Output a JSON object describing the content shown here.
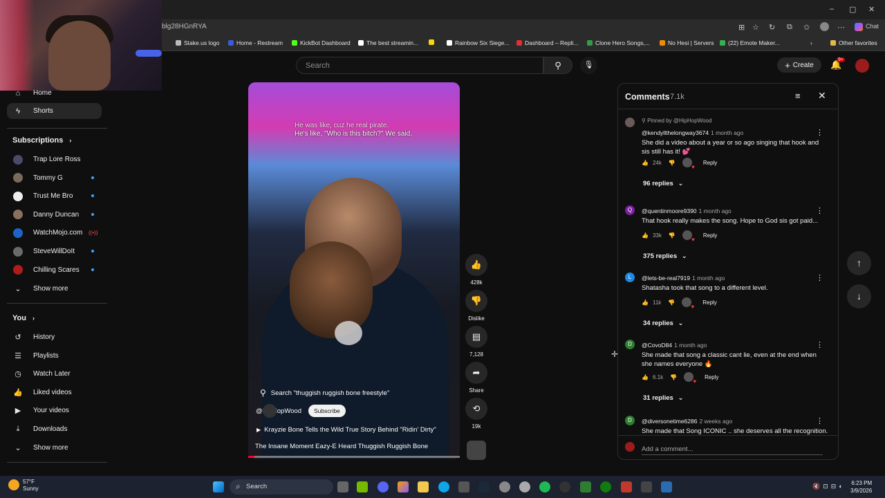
{
  "browser": {
    "url": "blg28HGnRYA",
    "bookmarks": [
      {
        "label": "Stake.us logo",
        "color": "#bbbbbb"
      },
      {
        "label": "Home - Restream",
        "color": "#3b5bdb"
      },
      {
        "label": "KickBot Dashboard",
        "color": "#53fc18"
      },
      {
        "label": "The best streamin...",
        "color": "#ffffff"
      },
      {
        "label": "",
        "color": "#f5d90a"
      },
      {
        "label": "Rainbow Six Siege...",
        "color": "#ffffff"
      },
      {
        "label": "Dashboard – Repli...",
        "color": "#e03131"
      },
      {
        "label": "Clone Hero Songs,...",
        "color": "#2f9e44"
      },
      {
        "label": "No Hesi | Servers",
        "color": "#f08c00"
      },
      {
        "label": "(22) Emote Maker...",
        "color": "#37b24d"
      }
    ],
    "other_favorites": "Other favorites",
    "copilot_label": "Chat"
  },
  "header": {
    "search_placeholder": "Search",
    "create_label": "Create",
    "notif_badge": "9+"
  },
  "sidebar": {
    "home": "Home",
    "shorts": "Shorts",
    "subscriptions_title": "Subscriptions",
    "channels": [
      {
        "name": "Trap Lore Ross",
        "color": "#4a4a6a",
        "indicator": ""
      },
      {
        "name": "Tommy G",
        "color": "#7a6a5a",
        "indicator": "dot"
      },
      {
        "name": "Trust Me Bro",
        "color": "#eeeeee",
        "indicator": "dot"
      },
      {
        "name": "Danny Duncan",
        "color": "#8a7060",
        "indicator": "dot"
      },
      {
        "name": "WatchMojo.com",
        "color": "#1e64c8",
        "indicator": "live"
      },
      {
        "name": "SteveWillDoIt",
        "color": "#6a6a6a",
        "indicator": "dot"
      },
      {
        "name": "Chilling Scares",
        "color": "#b01c1c",
        "indicator": "dot"
      }
    ],
    "show_more_1": "Show more",
    "you_title": "You",
    "you_items": [
      "History",
      "Playlists",
      "Watch Later",
      "Liked videos",
      "Your videos",
      "Downloads"
    ],
    "show_more_2": "Show more"
  },
  "video": {
    "caption_line1": "He was like, cuz he real pirate.",
    "caption_line2": "He's like, \"Who is this bitch?\" We said,",
    "search_suggestion": "Search \"thuggish ruggish bone freestyle\"",
    "channel": "@HipHopWood",
    "subscribe": "Subscribe",
    "related_title": "Krayzie Bone Tells the Wild True Story Behind \"Ridin' Dirty\"",
    "title": "The Insane Moment Eazy-E Heard Thuggish Ruggish Bone",
    "progress": 0.03
  },
  "actions": {
    "likes": "428k",
    "dislike": "Dislike",
    "comments": "7,128",
    "share": "Share",
    "remix": "19k"
  },
  "comments_panel": {
    "title": "Comments",
    "count": "7.1k",
    "add_placeholder": "Add a comment...",
    "items": [
      {
        "pinned": "Pinned by @HipHopWood",
        "user": "@kendyllthelongway3674",
        "time": "1 month ago",
        "text": "She did a video about a year or so ago singing that hook and sis still has it! 💕",
        "likes": "24k",
        "reply": "Reply",
        "replies": "96 replies",
        "avatar_letter": "",
        "avatar_color": "#6a5a5a"
      },
      {
        "pinned": "",
        "user": "@quentinmoore9390",
        "time": "1 month ago",
        "text": "That hook really makes the song. Hope to God sis got paid...",
        "likes": "33k",
        "reply": "Reply",
        "replies": "375 replies",
        "avatar_letter": "Q",
        "avatar_color": "#7b1fa2"
      },
      {
        "pinned": "",
        "user": "@lets-be-real7919",
        "time": "1 month ago",
        "text": "Shatasha took that song to a different level.",
        "likes": "11k",
        "reply": "Reply",
        "replies": "34 replies",
        "avatar_letter": "L",
        "avatar_color": "#1e88e5"
      },
      {
        "pinned": "",
        "user": "@CovoD84",
        "time": "1 month ago",
        "text": "She made that song a classic cant lie, even at the end when she names everyone 🔥",
        "likes": "6.1k",
        "reply": "Reply",
        "replies": "31 replies",
        "avatar_letter": "D",
        "avatar_color": "#2e7d32"
      },
      {
        "pinned": "",
        "user": "@diversonetime6286",
        "time": "2 weeks ago",
        "text": "She made that Song ICONIC .. she deserves all the recognition.",
        "likes": "",
        "reply": "",
        "replies": "",
        "avatar_letter": "D",
        "avatar_color": "#2e7d32"
      }
    ]
  },
  "taskbar": {
    "temp": "57°F",
    "weather": "Sunny",
    "search": "Search",
    "time": "6:23 PM",
    "date": "3/9/2026"
  }
}
